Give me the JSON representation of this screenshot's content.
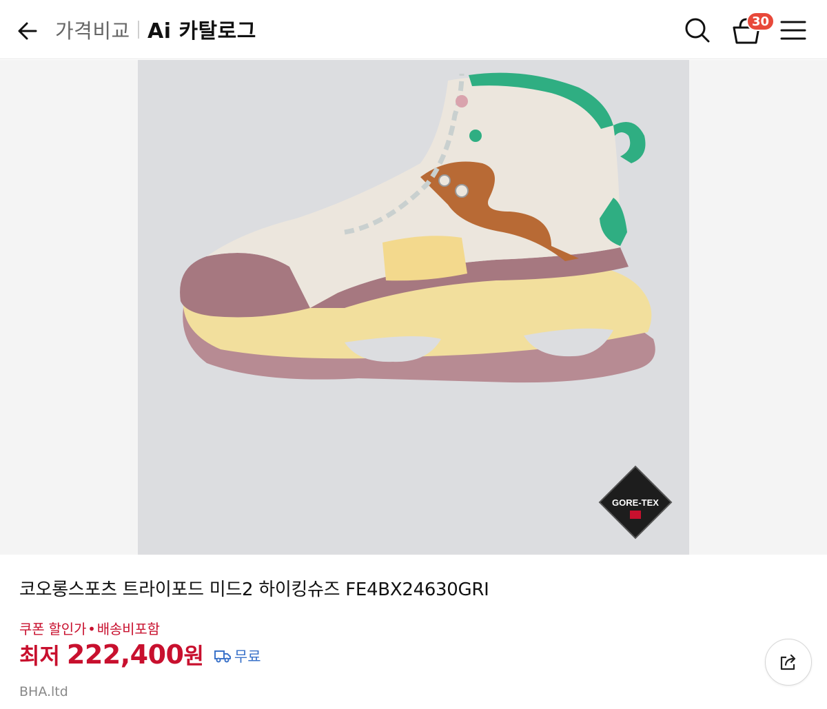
{
  "header": {
    "nav_text": "가격비교",
    "title": "Ai 카탈로그",
    "cart_count": "30",
    "icons": [
      "back-arrow-icon",
      "search-icon",
      "cart-basket-icon",
      "hamburger-menu-icon"
    ]
  },
  "product": {
    "image_alt": "코오롱스포츠 트라이포드 미드2 하이킹슈즈",
    "badge_text": "GORE-TEX",
    "name": "코오롱스포츠 트라이포드 미드2 하이킹슈즈 FE4BX24630GRI",
    "coupon_text": "쿠폰 할인가",
    "coupon_dot": "•",
    "shipping_included": "배송비포함",
    "price_label": "최저",
    "price_value": "222,400",
    "price_unit": "원",
    "shipping_free": "무료",
    "seller": "BHA.ltd"
  },
  "colors": {
    "accent_red": "#c8102e",
    "badge_red": "#e8493a",
    "shipping_blue": "#3a72c9",
    "image_bg": "#dcdde0"
  }
}
